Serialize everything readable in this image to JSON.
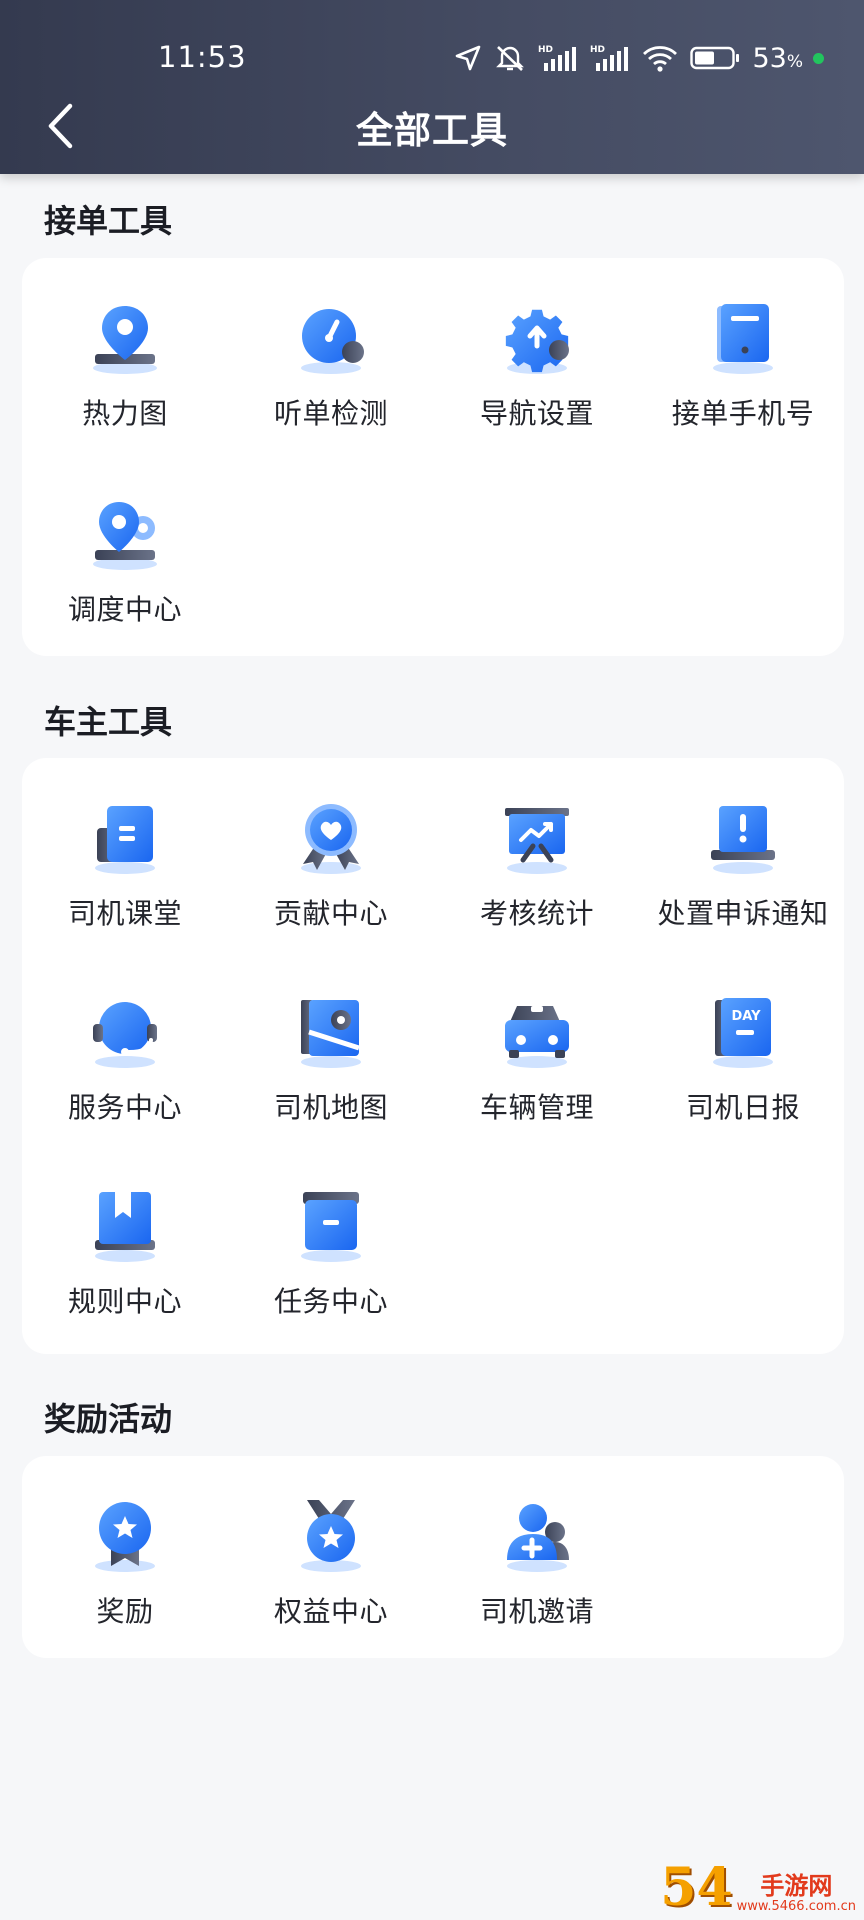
{
  "status_bar": {
    "time": "11:53",
    "battery_percent": "53",
    "battery_unit": "%"
  },
  "header": {
    "title": "全部工具"
  },
  "sections": [
    {
      "title": "接单工具",
      "items": [
        {
          "label": "热力图"
        },
        {
          "label": "听单检测"
        },
        {
          "label": "导航设置"
        },
        {
          "label": "接单手机号"
        },
        {
          "label": "调度中心"
        }
      ]
    },
    {
      "title": "车主工具",
      "items": [
        {
          "label": "司机课堂"
        },
        {
          "label": "贡献中心"
        },
        {
          "label": "考核统计"
        },
        {
          "label": "处置申诉通知"
        },
        {
          "label": "服务中心"
        },
        {
          "label": "司机地图"
        },
        {
          "label": "车辆管理"
        },
        {
          "label": "司机日报"
        },
        {
          "label": "规则中心"
        },
        {
          "label": "任务中心"
        }
      ]
    },
    {
      "title": "奖励活动",
      "items": [
        {
          "label": "奖励"
        },
        {
          "label": "权益中心"
        },
        {
          "label": "司机邀请"
        }
      ]
    }
  ],
  "icon_texts": {
    "day_badge": "DAY"
  },
  "watermark": {
    "number": "54",
    "name": "手游网",
    "domain": "www.5466.com.cn"
  },
  "colors": {
    "accent": "#2f7bf5",
    "accent_light": "#8dbbff",
    "header_dark": "#343a4f"
  }
}
